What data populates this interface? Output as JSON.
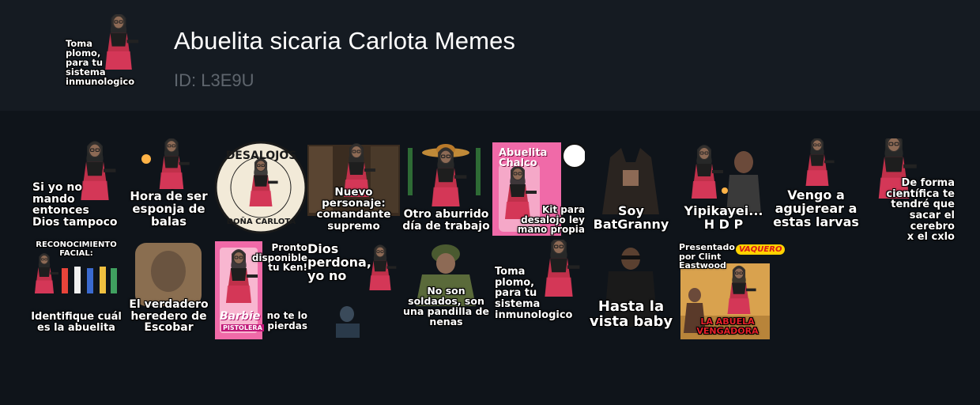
{
  "header": {
    "title": "Abuelita sicaria Carlota Memes",
    "id_label": "ID: L3E9U",
    "icon_caption": "Toma\nplomo,\npara tu\nsistema\ninmunologico"
  },
  "stickers": [
    {
      "caption": "Si yo no\nmando\nentonces\nDios tampoco"
    },
    {
      "caption": "Hora de ser\nesponja de\nbalas"
    },
    {
      "caption_top": "DESALOJOS",
      "caption_bottom": "DOÑA CARLOTA"
    },
    {
      "caption": "Nuevo\npersonaje:\ncomandante\nsupremo"
    },
    {
      "caption": "Otro aburrido\ndía de trabajo"
    },
    {
      "caption": "Kit para\ndesalojo ley\nmano propia",
      "box_title": "Abuelita\nChalco"
    },
    {
      "caption": "Soy\nBatGranny"
    },
    {
      "caption": "Yipikayei...\nH D P"
    },
    {
      "caption": "Vengo a\nagujerear a\nestas larvas"
    },
    {
      "caption": "De forma\ncientífica te\ntendré que\nsacar el cerebro\nx el cxlo"
    },
    {
      "caption_top": "RECONOCIMIENTO\nFACIAL:",
      "caption": "Identifique cuál\nes la abuelita"
    },
    {
      "caption": "El verdadero\nheredero de\nEscobar"
    },
    {
      "caption_top": "Pronto\ndisponible\ntu Ken!",
      "caption": "no te lo\npierdas",
      "brand": "Barbie",
      "brand_sub": "PISTOLERA"
    },
    {
      "caption": "Dios\nperdona,\nyo no"
    },
    {
      "caption": "No son\nsoldados, son\nuna pandilla de\nnenas"
    },
    {
      "caption": "Toma\nplomo,\npara tu\nsistema\ninmunologico"
    },
    {
      "caption": "Hasta la\nvista baby"
    },
    {
      "caption_top": "Presentado\npor Clint\nEastwood",
      "badge": "VAQUERO",
      "caption": "LA ABUELA\nVENGADORA"
    }
  ]
}
